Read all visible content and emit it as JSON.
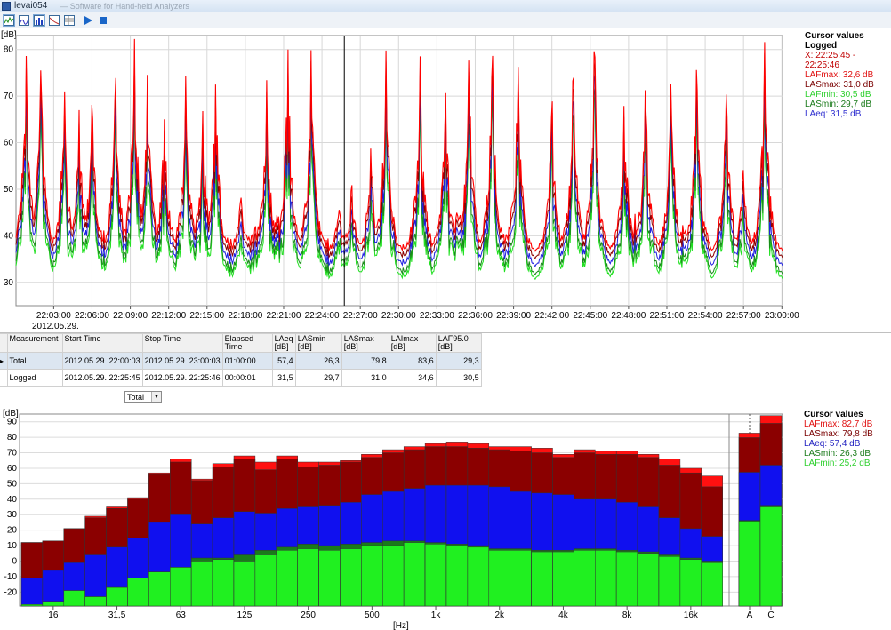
{
  "window": {
    "title": "levai054",
    "subtitle": "— Software for Hand-held Analyzers"
  },
  "toolbar": {
    "buttons": [
      "time-history-icon",
      "spectrum-icon",
      "octave-bands-icon",
      "statistics-icon",
      "table-icon",
      "play-icon",
      "stop-icon"
    ]
  },
  "time_history": {
    "y_unit": "[dB]",
    "date": "2012.05.29.",
    "y_ticks": [
      "30",
      "40",
      "50",
      "60",
      "70",
      "80"
    ],
    "x_ticks": [
      "22:03:00",
      "22:06:00",
      "22:09:00",
      "22:12:00",
      "22:15:00",
      "22:18:00",
      "22:21:00",
      "22:24:00",
      "22:27:00",
      "22:30:00",
      "22:33:00",
      "22:36:00",
      "22:39:00",
      "22:42:00",
      "22:45:00",
      "22:48:00",
      "22:51:00",
      "22:54:00",
      "22:57:00",
      "23:00:00"
    ],
    "cursor_legend": {
      "header": "Cursor values",
      "subheader": "Logged",
      "entries": [
        {
          "text": "X: 22:25:45 - 22:25:46",
          "color": "#c00000"
        },
        {
          "text": "LAFmax: 32,6 dB",
          "color": "#e01010"
        },
        {
          "text": "LASmax: 31,0 dB",
          "color": "#7a0000"
        },
        {
          "text": "LAFmin: 30,5 dB",
          "color": "#30d030"
        },
        {
          "text": "LASmin: 29,7 dB",
          "color": "#1a7a1a"
        },
        {
          "text": "LAeq: 31,5 dB",
          "color": "#3030d0"
        }
      ]
    }
  },
  "chart_data": [
    {
      "type": "line",
      "xlabel": "",
      "ylabel": "[dB]",
      "ylim": [
        25,
        83
      ],
      "x_range": [
        "22:00:03",
        "23:00:03"
      ],
      "cursor_time": "22:25:45",
      "series": [
        {
          "name": "LAFmax",
          "color": "#ff0000"
        },
        {
          "name": "LASmax",
          "color": "#8b0000"
        },
        {
          "name": "LAeq",
          "color": "#2020e0"
        },
        {
          "name": "LASmin",
          "color": "#1a8a1a"
        },
        {
          "name": "LAFmin",
          "color": "#20e020"
        }
      ],
      "peaks": [
        {
          "t": "22:00:50",
          "v": 80
        },
        {
          "t": "22:02:00",
          "v": 77
        },
        {
          "t": "22:03:50",
          "v": 71
        },
        {
          "t": "22:05:00",
          "v": 67
        },
        {
          "t": "22:06:00",
          "v": 70
        },
        {
          "t": "22:07:50",
          "v": 75
        },
        {
          "t": "22:09:20",
          "v": 83
        },
        {
          "t": "22:10:20",
          "v": 76
        },
        {
          "t": "22:11:40",
          "v": 66
        },
        {
          "t": "22:13:20",
          "v": 75
        },
        {
          "t": "22:14:40",
          "v": 67
        },
        {
          "t": "22:15:40",
          "v": 73
        },
        {
          "t": "22:17:40",
          "v": 50
        },
        {
          "t": "22:19:40",
          "v": 74
        },
        {
          "t": "22:21:20",
          "v": 80
        },
        {
          "t": "22:23:10",
          "v": 80
        },
        {
          "t": "22:25:20",
          "v": 47
        },
        {
          "t": "22:26:20",
          "v": 52
        },
        {
          "t": "22:27:50",
          "v": 59
        },
        {
          "t": "22:29:00",
          "v": 80
        },
        {
          "t": "22:31:40",
          "v": 80
        },
        {
          "t": "22:33:40",
          "v": 72
        },
        {
          "t": "22:35:30",
          "v": 78
        },
        {
          "t": "22:37:20",
          "v": 80
        },
        {
          "t": "22:39:20",
          "v": 78
        },
        {
          "t": "22:42:00",
          "v": 69
        },
        {
          "t": "22:43:40",
          "v": 75
        },
        {
          "t": "22:45:20",
          "v": 80
        },
        {
          "t": "22:47:40",
          "v": 68
        },
        {
          "t": "22:49:20",
          "v": 73
        },
        {
          "t": "22:51:20",
          "v": 74
        },
        {
          "t": "22:53:20",
          "v": 76
        },
        {
          "t": "22:55:40",
          "v": 72
        },
        {
          "t": "22:57:00",
          "v": 56
        },
        {
          "t": "22:58:40",
          "v": 82
        }
      ]
    },
    {
      "type": "bar",
      "title": "",
      "xlabel": "[Hz]",
      "ylabel": "[dB]",
      "ylim": [
        -29,
        95
      ],
      "x_tick_labels": [
        "16",
        "31,5",
        "63",
        "125",
        "250",
        "500",
        "1k",
        "2k",
        "4k",
        "8k",
        "16k",
        "A",
        "C"
      ],
      "categories": [
        "12.5",
        "16",
        "20",
        "25",
        "31.5",
        "40",
        "50",
        "63",
        "80",
        "100",
        "125",
        "160",
        "200",
        "250",
        "315",
        "400",
        "500",
        "630",
        "800",
        "1k",
        "1.25k",
        "1.6k",
        "2k",
        "2.5k",
        "3.15k",
        "4k",
        "5k",
        "6.3k",
        "8k",
        "10k",
        "12.5k",
        "16k",
        "20k",
        "A",
        "C"
      ],
      "series": [
        {
          "name": "LAFmax",
          "color": "#ff1010",
          "values": [
            12,
            13,
            21,
            29,
            35,
            41,
            57,
            66,
            53,
            63,
            68,
            64,
            68,
            64,
            64,
            65,
            69,
            72,
            74,
            76,
            77,
            76,
            74,
            74,
            73,
            69,
            72,
            71,
            71,
            69,
            66,
            60,
            55,
            82.7,
            94
          ]
        },
        {
          "name": "LASmax",
          "color": "#8b0000",
          "values": [
            12,
            13,
            21,
            28,
            34,
            40,
            56,
            64,
            52,
            61,
            66,
            59,
            66,
            61,
            62,
            64,
            67,
            70,
            72,
            74,
            74,
            73,
            72,
            71,
            70,
            67,
            70,
            69,
            69,
            67,
            62,
            57,
            48,
            79.8,
            89
          ]
        },
        {
          "name": "LAeq",
          "color": "#1010ef",
          "values": [
            -11,
            -6,
            -1,
            4,
            9,
            15,
            25,
            30,
            24,
            28,
            32,
            31,
            34,
            35,
            36,
            38,
            43,
            45,
            47,
            49,
            49,
            49,
            48,
            45,
            44,
            43,
            40,
            40,
            38,
            35,
            28,
            21,
            16,
            57.4,
            62
          ]
        },
        {
          "name": "LASmin",
          "color": "#1a7a1a",
          "values": [
            -28,
            -26,
            -19,
            -23,
            -17,
            -11,
            -7,
            -4,
            2,
            2,
            4,
            7,
            9,
            11,
            10,
            11,
            12,
            13,
            13,
            12,
            11,
            10,
            8,
            8,
            7,
            7,
            8,
            8,
            7,
            6,
            4,
            2,
            0,
            26.3,
            36
          ]
        },
        {
          "name": "LAFmin",
          "color": "#20f020",
          "values": [
            -28,
            -26,
            -19,
            -23,
            -17,
            -11,
            -7,
            -4,
            0,
            1,
            0,
            4,
            7,
            8,
            7,
            8,
            10,
            10,
            12,
            11,
            10,
            9,
            7,
            7,
            6,
            6,
            7,
            7,
            6,
            5,
            3,
            1,
            -1,
            25.2,
            35
          ]
        }
      ]
    }
  ],
  "spectrum": {
    "y_unit": "[dB]",
    "x_unit": "[Hz]",
    "y_ticks": [
      "-20",
      "-10",
      "0",
      "10",
      "20",
      "30",
      "40",
      "50",
      "60",
      "70",
      "80",
      "90"
    ],
    "cursor_legend": {
      "header": "Cursor values",
      "entries": [
        {
          "text": "LAFmax: 82,7 dB",
          "color": "#e01010"
        },
        {
          "text": "LASmax: 79,8 dB",
          "color": "#7a0000"
        },
        {
          "text": "LAeq: 57,4 dB",
          "color": "#2020c0"
        },
        {
          "text": "LASmin: 26,3 dB",
          "color": "#1a7a1a"
        },
        {
          "text": "LAFmin: 25,2 dB",
          "color": "#30d030"
        }
      ]
    }
  },
  "table": {
    "headers": [
      "Measurement",
      "Start Time",
      "Stop Time",
      "Elapsed Time",
      "LAeq\n[dB]",
      "LASmin\n[dB]",
      "LASmax\n[dB]",
      "LAImax\n[dB]",
      "LAF95.0\n[dB]"
    ],
    "rows": [
      [
        "Total",
        "2012.05.29. 22:00:03",
        "2012.05.29. 23:00:03",
        "01:00:00",
        "57,4",
        "26,3",
        "79,8",
        "83,6",
        "29,3"
      ],
      [
        "Logged",
        "2012.05.29. 22:25:45",
        "2012.05.29. 22:25:46",
        "00:00:01",
        "31,5",
        "29,7",
        "31,0",
        "34,6",
        "30,5"
      ]
    ]
  },
  "selector": {
    "value": "Total"
  }
}
